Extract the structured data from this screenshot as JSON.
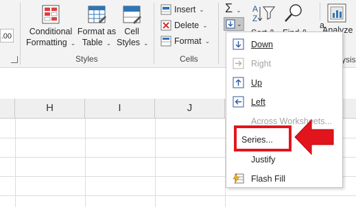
{
  "ribbon": {
    "number_format_preview": ".00",
    "styles_group": {
      "label": "Styles",
      "conditional_formatting": {
        "line1": "Conditional",
        "line2": "Formatting"
      },
      "format_as_table": {
        "line1": "Format as",
        "line2": "Table"
      },
      "cell_styles": {
        "line1": "Cell",
        "line2": "Styles"
      }
    },
    "cells_group": {
      "label": "Cells",
      "insert": "Insert",
      "delete": "Delete",
      "format": "Format"
    },
    "editing_group": {
      "sort_filter_partial": "Sort &",
      "find_select_partial": "Find &",
      "analyze_partial": "Analyze",
      "analysis_partial": "ysis",
      "a_partial": "a"
    }
  },
  "columns": [
    "H",
    "I",
    "J"
  ],
  "fill_menu": {
    "items": [
      {
        "label": "Down",
        "icon": "fill-down-icon",
        "enabled": true
      },
      {
        "label": "Right",
        "icon": "fill-right-icon",
        "enabled": false
      },
      {
        "label": "Up",
        "icon": "fill-up-icon",
        "enabled": true
      },
      {
        "label": "Left",
        "icon": "fill-left-icon",
        "enabled": true
      },
      {
        "label": "Across Worksheets...",
        "icon": "",
        "enabled": false
      },
      {
        "label": "Series...",
        "icon": "",
        "enabled": true,
        "highlighted": true
      },
      {
        "label": "Justify",
        "icon": "",
        "enabled": true
      },
      {
        "label": "Flash Fill",
        "icon": "flash-fill-icon",
        "enabled": true
      }
    ]
  },
  "colors": {
    "highlight_red": "#e2141c",
    "icon_blue": "#2b579a",
    "ribbon_bg": "#f3f3f3"
  }
}
